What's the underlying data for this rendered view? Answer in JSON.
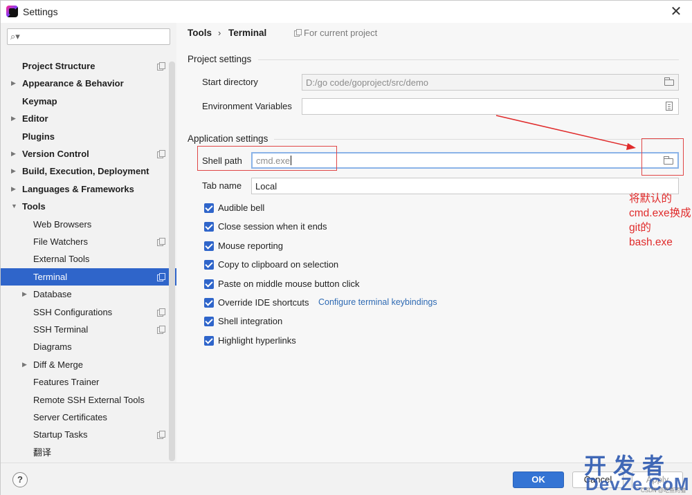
{
  "window": {
    "title": "Settings"
  },
  "search": {
    "placeholder": ""
  },
  "sidebar": {
    "items": [
      {
        "label": "Project Structure",
        "bold": true,
        "arrow": false,
        "indent": 0,
        "proj": true
      },
      {
        "label": "Appearance & Behavior",
        "bold": true,
        "arrow": "right",
        "indent": 0,
        "proj": false
      },
      {
        "label": "Keymap",
        "bold": true,
        "arrow": false,
        "indent": 0,
        "proj": false
      },
      {
        "label": "Editor",
        "bold": true,
        "arrow": "right",
        "indent": 0,
        "proj": false
      },
      {
        "label": "Plugins",
        "bold": true,
        "arrow": false,
        "indent": 0,
        "proj": false
      },
      {
        "label": "Version Control",
        "bold": true,
        "arrow": "right",
        "indent": 0,
        "proj": true
      },
      {
        "label": "Build, Execution, Deployment",
        "bold": true,
        "arrow": "right",
        "indent": 0,
        "proj": false
      },
      {
        "label": "Languages & Frameworks",
        "bold": true,
        "arrow": "right",
        "indent": 0,
        "proj": false
      },
      {
        "label": "Tools",
        "bold": true,
        "arrow": "down",
        "indent": 0,
        "proj": false
      },
      {
        "label": "Web Browsers",
        "bold": false,
        "arrow": false,
        "indent": 1,
        "proj": false
      },
      {
        "label": "File Watchers",
        "bold": false,
        "arrow": false,
        "indent": 1,
        "proj": true
      },
      {
        "label": "External Tools",
        "bold": false,
        "arrow": false,
        "indent": 1,
        "proj": false
      },
      {
        "label": "Terminal",
        "bold": false,
        "arrow": false,
        "indent": 1,
        "proj": true,
        "selected": true
      },
      {
        "label": "Database",
        "bold": false,
        "arrow": "right",
        "indent": 1,
        "proj": false
      },
      {
        "label": "SSH Configurations",
        "bold": false,
        "arrow": false,
        "indent": 1,
        "proj": true
      },
      {
        "label": "SSH Terminal",
        "bold": false,
        "arrow": false,
        "indent": 1,
        "proj": true
      },
      {
        "label": "Diagrams",
        "bold": false,
        "arrow": false,
        "indent": 1,
        "proj": false
      },
      {
        "label": "Diff & Merge",
        "bold": false,
        "arrow": "right",
        "indent": 1,
        "proj": false
      },
      {
        "label": "Features Trainer",
        "bold": false,
        "arrow": false,
        "indent": 1,
        "proj": false
      },
      {
        "label": "Remote SSH External Tools",
        "bold": false,
        "arrow": false,
        "indent": 1,
        "proj": false
      },
      {
        "label": "Server Certificates",
        "bold": false,
        "arrow": false,
        "indent": 1,
        "proj": false
      },
      {
        "label": "Startup Tasks",
        "bold": false,
        "arrow": false,
        "indent": 1,
        "proj": true
      },
      {
        "label": "翻译",
        "bold": false,
        "arrow": false,
        "indent": 1,
        "proj": false
      }
    ]
  },
  "breadcrumb": {
    "parent": "Tools",
    "separator": "›",
    "current": "Terminal",
    "scope": "For current project"
  },
  "project_settings": {
    "title": "Project settings",
    "start_directory_label": "Start directory",
    "start_directory_value": "D:/go code/goproject/src/demo",
    "env_vars_label": "Environment Variables",
    "env_vars_value": ""
  },
  "app_settings": {
    "title": "Application settings",
    "shell_path_label": "Shell path",
    "shell_path_value": "cmd.exe",
    "tab_name_label": "Tab name",
    "tab_name_value": "Local",
    "options": [
      {
        "label": "Audible bell",
        "checked": true
      },
      {
        "label": "Close session when it ends",
        "checked": true
      },
      {
        "label": "Mouse reporting",
        "checked": true
      },
      {
        "label": "Copy to clipboard on selection",
        "checked": true
      },
      {
        "label": "Paste on middle mouse button click",
        "checked": true
      },
      {
        "label": "Override IDE shortcuts",
        "checked": true
      },
      {
        "label": "Shell integration",
        "checked": true
      },
      {
        "label": "Highlight hyperlinks",
        "checked": true
      }
    ],
    "keybindings_link": "Configure terminal keybindings"
  },
  "annotation": {
    "text": "将默认的cmd.exe换成git的bash.exe",
    "color": "#e02b2b"
  },
  "footer": {
    "help_label": "?",
    "ok_label": "OK",
    "cancel_label": "Cancel",
    "apply_label": "Apply"
  },
  "watermark": {
    "big": "开发者",
    "dom": "DevZe.CoM",
    "small": "CSDN @吃鱼的猫"
  },
  "colors": {
    "accent": "#2f65ca",
    "ok_button": "#3474d4",
    "link": "#2e6ab3"
  }
}
